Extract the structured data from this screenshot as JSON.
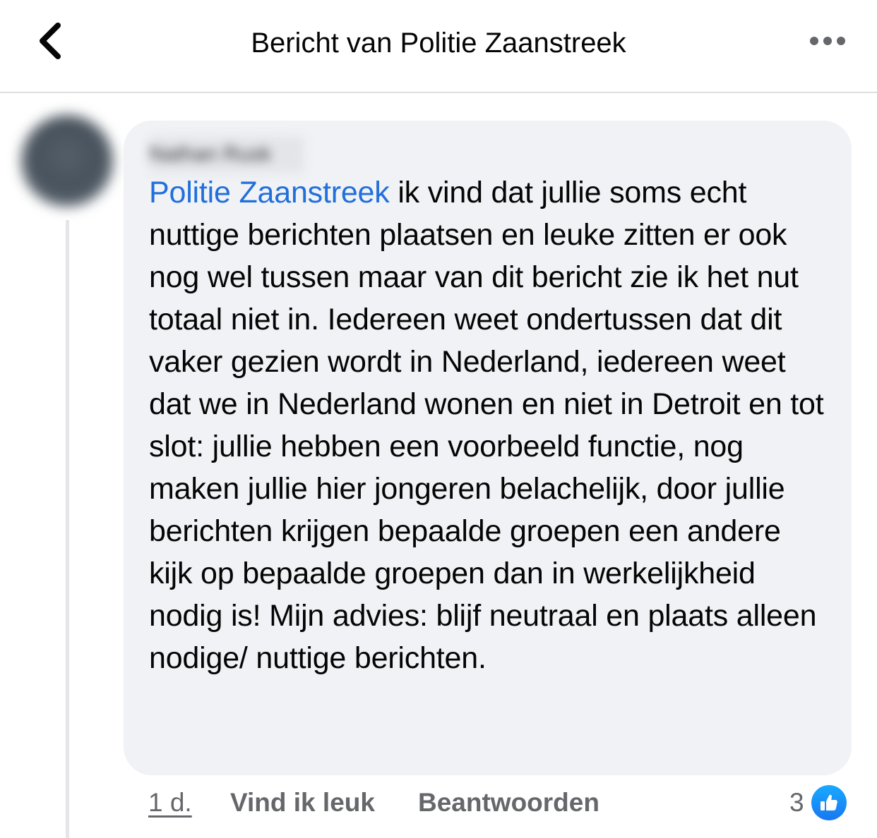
{
  "header": {
    "title": "Bericht van Politie Zaanstreek",
    "back_icon": "chevron-left-icon",
    "more_icon": "more-horizontal-icon"
  },
  "comment": {
    "author": "Nathan Rusk",
    "mention": "Politie Zaanstreek",
    "text": " ik vind dat jullie soms echt nuttige berichten plaatsen en leuke zitten er ook nog wel tussen maar van dit bericht zie ik het nut totaal niet in. Iedereen weet ondertussen dat dit vaker gezien wordt in Nederland, iedereen weet dat we in Nederland wonen en niet in Detroit en tot slot: jullie hebben een voorbeeld functie, nog maken jullie hier jongeren belachelijk, door jullie berichten krijgen bepaalde groepen een andere kijk op bepaalde groepen dan in werkelijkheid nodig is! Mijn advies: blijf neutraal en plaats alleen nodige/ nuttige berichten.",
    "time": "1 d.",
    "like_label": "Vind ik leuk",
    "reply_label": "Beantwoorden",
    "reaction_count": "3",
    "reaction_icon": "thumbs-up-icon"
  },
  "colors": {
    "mention": "#216fdb",
    "bubble": "#f0f2f5",
    "meta_text": "#65676b",
    "like_badge": "#1877f2"
  }
}
